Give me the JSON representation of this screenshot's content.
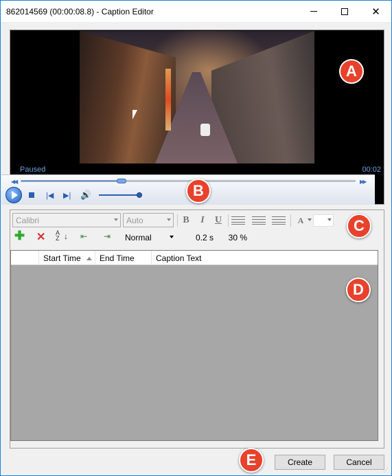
{
  "window": {
    "title": "862014569 (00:00:08.8) - Caption Editor",
    "min_icon": "minimize-icon",
    "max_icon": "maximize-icon",
    "close_glyph": "✕"
  },
  "video": {
    "status": "Paused",
    "time": "00:02",
    "seek_progress": 0.3
  },
  "badges": {
    "a": "A",
    "b": "B",
    "c": "C",
    "d": "D",
    "e": "E"
  },
  "badge_color": "#e8412c",
  "transport": {
    "volume_level": 0.95
  },
  "format_toolbar": {
    "font": "Calibri",
    "size": "Auto",
    "bold": "B",
    "italic": "I",
    "underline": "U",
    "font_color_glyph": "A"
  },
  "edit_toolbar": {
    "style": "Normal",
    "duration": "0.2 s",
    "percent": "30 %",
    "sort_glyph": "A Z"
  },
  "grid": {
    "columns": [
      "",
      "Start Time",
      "End Time",
      "Caption Text"
    ],
    "rows": []
  },
  "buttons": {
    "create": "Create",
    "cancel": "Cancel"
  }
}
